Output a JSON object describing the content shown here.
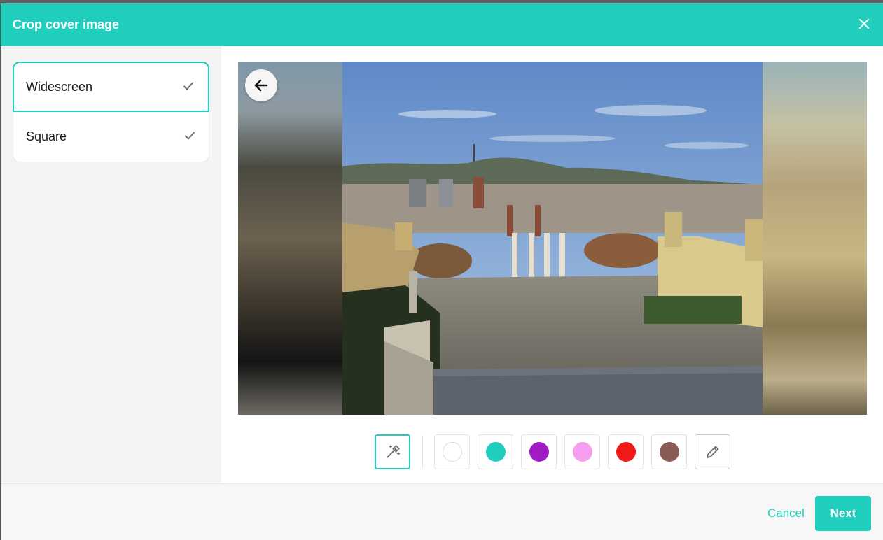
{
  "dialog": {
    "title": "Crop cover image",
    "close_icon": "close-icon"
  },
  "aspect_options": [
    {
      "label": "Widescreen",
      "selected": true,
      "icon": "check-icon"
    },
    {
      "label": "Square",
      "selected": false,
      "icon": "check-icon"
    }
  ],
  "editor": {
    "back_icon": "arrow-left-icon",
    "image_description_icon": "cover-image"
  },
  "background_tools": {
    "magic_icon": "magic-wand-icon",
    "swatches": [
      {
        "name": "white",
        "color": "#ffffff"
      },
      {
        "name": "teal",
        "color": "#20cebd"
      },
      {
        "name": "purple",
        "color": "#a11cc4"
      },
      {
        "name": "pink",
        "color": "#f4a0ee"
      },
      {
        "name": "red",
        "color": "#f01a1a"
      },
      {
        "name": "brown",
        "color": "#8a5a57"
      }
    ],
    "custom_icon": "pencil-icon"
  },
  "footer": {
    "cancel_label": "Cancel",
    "next_label": "Next"
  },
  "colors": {
    "accent": "#20cebd",
    "sidebar_bg": "#f4f4f4"
  }
}
